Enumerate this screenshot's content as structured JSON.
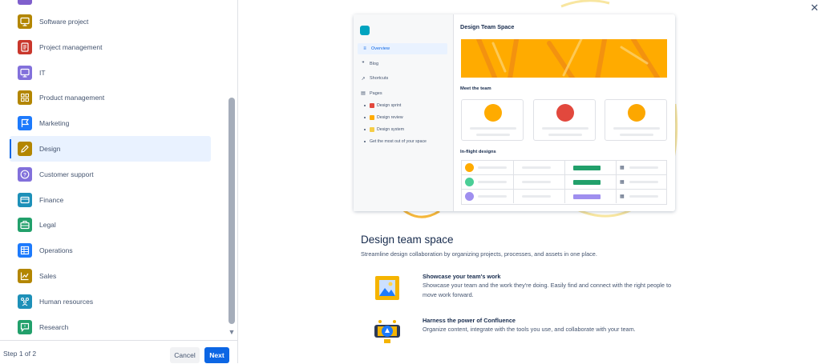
{
  "categories": [
    {
      "label": "Software project",
      "color": "#b38600",
      "icon": "monitor-icon"
    },
    {
      "label": "Project management",
      "color": "#c9372c",
      "icon": "document-icon"
    },
    {
      "label": "IT",
      "color": "#8270db",
      "icon": "monitor-icon"
    },
    {
      "label": "Product management",
      "color": "#b38600",
      "icon": "grid-icon"
    },
    {
      "label": "Marketing",
      "color": "#1d7afc",
      "icon": "flag-icon"
    },
    {
      "label": "Design",
      "color": "#b38600",
      "icon": "pencil-icon",
      "selected": true
    },
    {
      "label": "Customer support",
      "color": "#8270db",
      "icon": "question-icon"
    },
    {
      "label": "Finance",
      "color": "#1d90b8",
      "icon": "card-icon"
    },
    {
      "label": "Legal",
      "color": "#22a06b",
      "icon": "briefcase-icon"
    },
    {
      "label": "Operations",
      "color": "#1d7afc",
      "icon": "table-icon"
    },
    {
      "label": "Sales",
      "color": "#b38600",
      "icon": "chart-icon"
    },
    {
      "label": "Human resources",
      "color": "#1d90b8",
      "icon": "people-icon"
    },
    {
      "label": "Research",
      "color": "#22a06b",
      "icon": "comment-icon"
    }
  ],
  "footer": {
    "step": "Step 1 of 2",
    "cancel": "Cancel",
    "next": "Next"
  },
  "preview": {
    "title": "Design Team Space",
    "nav": [
      {
        "label": "Overview",
        "glyph": "≡",
        "icon": "overview-icon",
        "active": true
      },
      {
        "label": "Blog",
        "glyph": "❞",
        "icon": "quote-icon"
      },
      {
        "label": "Shortcuts",
        "glyph": "↗",
        "icon": "shortcut-icon"
      },
      {
        "label": "Pages",
        "glyph": "▤",
        "icon": "pages-icon"
      }
    ],
    "pages": [
      {
        "label": "Design sprint",
        "color": "#e2483d"
      },
      {
        "label": "Design review",
        "color": "#ffab00"
      },
      {
        "label": "Design system",
        "color": "#f5cd47"
      },
      {
        "label": "Get the most out of your space",
        "color": ""
      }
    ],
    "meet_team": "Meet the team",
    "inflight": "In-flight designs",
    "members": [
      {
        "color": "#ffab00"
      },
      {
        "color": "#e2483d"
      },
      {
        "color": "#fca700"
      }
    ],
    "rows": [
      {
        "avatar": "#ffab00",
        "pill": "#22a06b"
      },
      {
        "avatar": "#4bce97",
        "pill": "#22a06b"
      },
      {
        "avatar": "#9f8fef",
        "pill": "#9f8fef"
      }
    ]
  },
  "template": {
    "headline": "Design team space",
    "subline": "Streamline design collaboration by organizing projects, processes, and assets in one place.",
    "features": [
      {
        "title": "Showcase your team's work",
        "desc": "Showcase your team and the work they're doing. Easily find and connect with the right people to move work forward.",
        "icon": "picture-frame-icon"
      },
      {
        "title": "Harness the power of Confluence",
        "desc": "Organize content, integrate with the tools you use, and collaborate with your team.",
        "icon": "confluence-badge-icon"
      }
    ]
  }
}
